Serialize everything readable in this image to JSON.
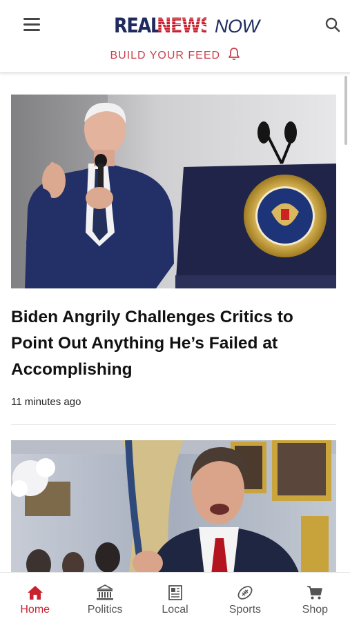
{
  "header": {
    "logo": {
      "real": "REAL",
      "news": "NEWS",
      "now": "NOW"
    },
    "build_feed_label": "BUILD YOUR FEED",
    "icons": [
      "menu-icon",
      "search-icon",
      "bell-icon"
    ]
  },
  "colors": {
    "brand_navy": "#1f2b5e",
    "brand_red": "#c8222f",
    "active_nav": "#c8222f",
    "inactive_nav": "#555555"
  },
  "articles": [
    {
      "headline": "Biden Angrily Challenges Critics to Point Out Anything He’s Failed at Accomplishing",
      "timestamp": "11 minutes ago"
    }
  ],
  "bottom_nav": {
    "active": "Home",
    "items": [
      {
        "label": "Home",
        "icon": "home-icon"
      },
      {
        "label": "Politics",
        "icon": "capitol-icon"
      },
      {
        "label": "Local",
        "icon": "newspaper-icon"
      },
      {
        "label": "Sports",
        "icon": "football-icon"
      },
      {
        "label": "Shop",
        "icon": "cart-icon"
      }
    ]
  }
}
